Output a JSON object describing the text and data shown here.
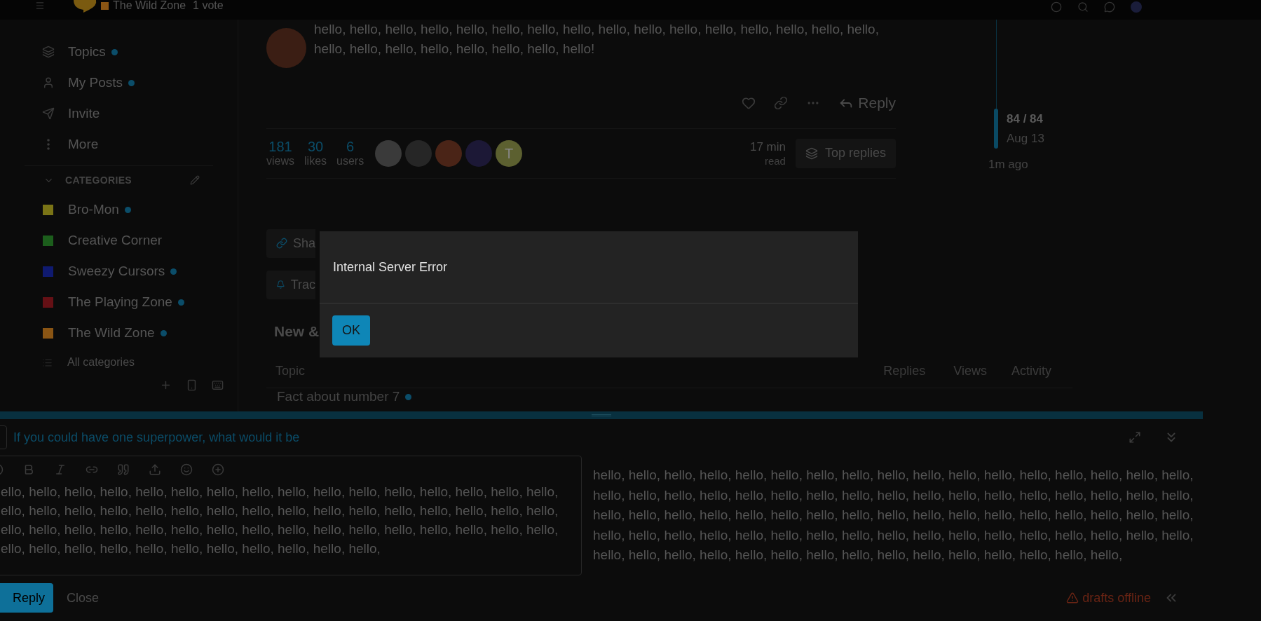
{
  "header": {
    "category": {
      "name": "The Wild Zone",
      "color": "#8a5514"
    },
    "votes": "1 vote"
  },
  "sidebar": {
    "nav": [
      {
        "label": "Topics",
        "unread": true
      },
      {
        "label": "My Posts",
        "unread": true
      },
      {
        "label": "Invite",
        "unread": false
      },
      {
        "label": "More",
        "unread": false
      }
    ],
    "categories_heading": "CATEGORIES",
    "categories": [
      {
        "name": "Bro-Mon",
        "color": "#7a7416",
        "unread": true
      },
      {
        "name": "Creative Corner",
        "color": "#1c5e1c",
        "unread": false
      },
      {
        "name": "Sweezy Cursors",
        "color": "#0f1a70",
        "unread": true
      },
      {
        "name": "The Playing Zone",
        "color": "#651015",
        "unread": true
      },
      {
        "name": "The Wild Zone",
        "color": "#8a5514",
        "unread": true
      }
    ],
    "all_categories": "All categories"
  },
  "post": {
    "text_lines": [
      "hello, hello, hello, hello, hello, hello, hello, hello, hello, hello, hello, hello, hello, hello, hello, hello,",
      "hello, hello, hello, hello, hello, hello, hello, hello!"
    ],
    "reply": "Reply"
  },
  "topic_map": {
    "stats": [
      {
        "value": "181",
        "label": "views"
      },
      {
        "value": "30",
        "label": "likes"
      },
      {
        "value": "6",
        "label": "users"
      }
    ],
    "participants": [
      {
        "kind": "photo",
        "color": "#3a3a3a"
      },
      {
        "kind": "photo",
        "color": "#262626"
      },
      {
        "kind": "photo",
        "color": "#4a2417"
      },
      {
        "kind": "photo",
        "color": "#1c1836"
      },
      {
        "kind": "letter",
        "letter": "T",
        "color": "#5c6030"
      }
    ],
    "read_time": {
      "value": "17 min",
      "label": "read"
    },
    "top_replies": "Top replies"
  },
  "topic_buttons": [
    {
      "label": "Sha"
    },
    {
      "label": "Trac"
    }
  ],
  "suggested": {
    "heading": "New &",
    "columns": [
      "Topic",
      "Replies",
      "Views",
      "Activity"
    ],
    "rows": [
      {
        "title": "Fact about number 7",
        "unread": true
      }
    ]
  },
  "timeline": {
    "position": "84 / 84",
    "date": "Aug 13",
    "last": "1m ago"
  },
  "dialog": {
    "message": "Internal Server Error",
    "button": "OK"
  },
  "composer": {
    "title": "If you could have one superpower, what would it be",
    "editor_lines": [
      "ello, hello, hello, hello, hello, hello, hello, hello, hello, hello, hello, hello, hello, hello, hello, hello,",
      "ello, hello, hello, hello, hello, hello, hello, hello, hello, hello, hello, hello, hello, hello, hello, hello,",
      "ello, hello, hello, hello, hello, hello, hello, hello, hello, hello, hello, hello, hello, hello, hello, hello,",
      "ello, hello, hello, hello, hello, hello, hello, hello, hello, hello, hello,"
    ],
    "preview_lines": [
      "hello, hello, hello, hello, hello, hello, hello, hello, hello, hello, hello, hello, hello, hello, hello, hello, hello,",
      "hello, hello, hello, hello, hello, hello, hello, hello, hello, hello, hello, hello, hello, hello, hello, hello, hello,",
      "hello, hello, hello, hello, hello, hello, hello, hello, hello, hello, hello, hello, hello, hello, hello, hello, hello,",
      "hello, hello, hello, hello, hello, hello, hello, hello, hello, hello, hello, hello, hello, hello, hello, hello, hello,",
      "hello, hello, hello, hello, hello, hello, hello, hello, hello, hello, hello, hello, hello, hello, hello,"
    ],
    "submit": "Reply",
    "cancel": "Close",
    "draft_status": "drafts offline"
  }
}
